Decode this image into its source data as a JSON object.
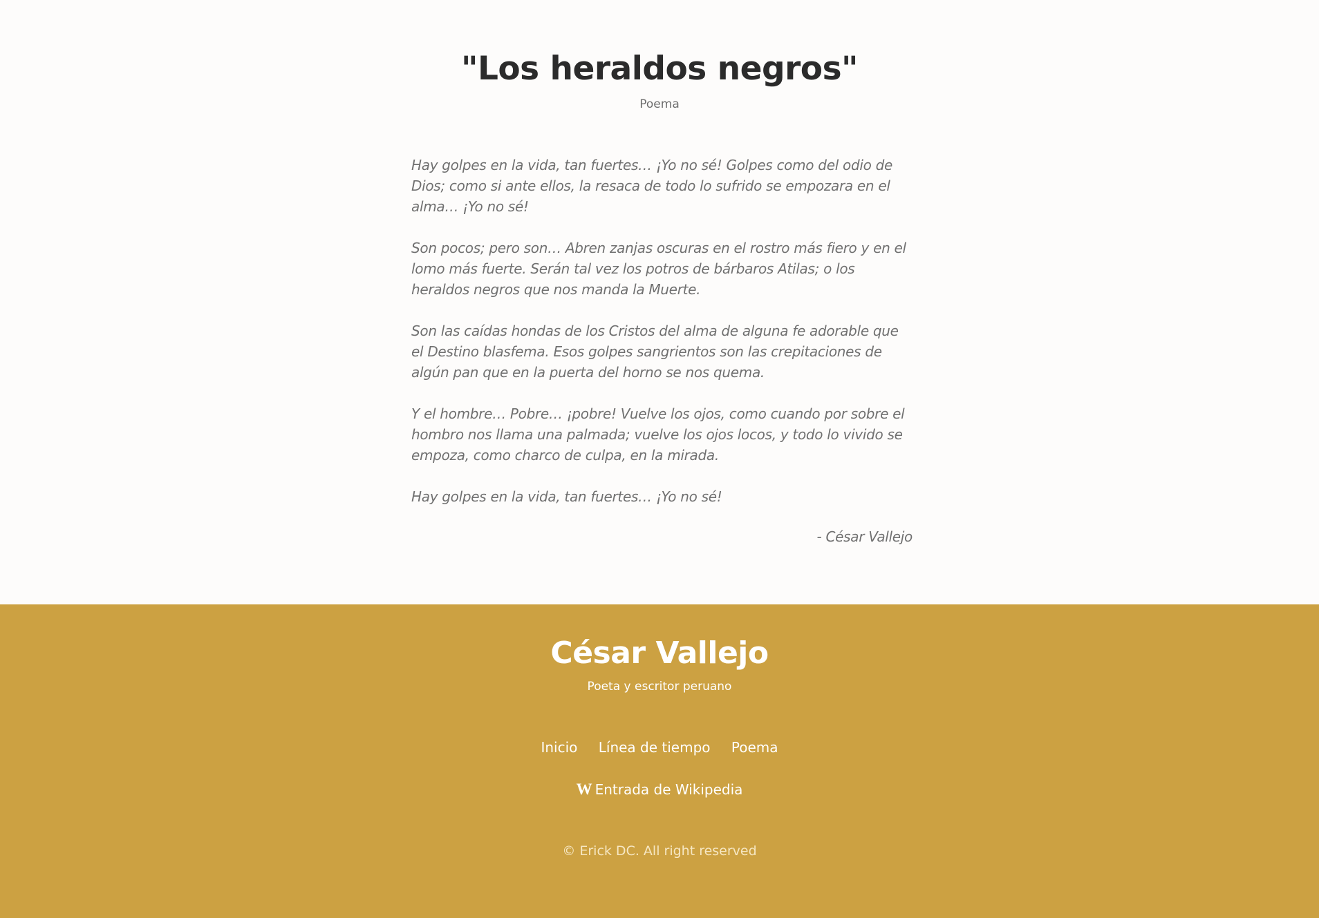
{
  "poem": {
    "title": "\"Los heraldos negros\"",
    "subtitle": "Poema",
    "stanzas": [
      "Hay golpes en la vida, tan fuertes… ¡Yo no sé! Golpes como del odio de Dios; como si ante ellos, la resaca de todo lo sufrido se empozara en el alma… ¡Yo no sé!",
      "Son pocos; pero son… Abren zanjas oscuras en el rostro más fiero y en el lomo más fuerte. Serán tal vez los potros de bárbaros Atilas; o los heraldos negros que nos manda la Muerte.",
      "Son las caídas hondas de los Cristos del alma de alguna fe adorable que el Destino blasfema. Esos golpes sangrientos son las crepitaciones de algún pan que en la puerta del horno se nos quema.",
      "Y el hombre… Pobre… ¡pobre! Vuelve los ojos, como cuando por sobre el hombro nos llama una palmada; vuelve los ojos locos, y todo lo vivido se empoza, como charco de culpa, en la mirada.",
      "Hay golpes en la vida, tan fuertes… ¡Yo no sé!"
    ],
    "author": "- César Vallejo"
  },
  "footer": {
    "name": "César Vallejo",
    "tagline": "Poeta y escritor peruano",
    "nav": [
      "Inicio",
      "Línea de tiempo",
      "Poema"
    ],
    "wiki_icon": "W",
    "wiki_label": "Entrada de Wikipedia",
    "copyright": "© Erick DC. All right reserved"
  },
  "colors": {
    "footer_bg": "#cca142",
    "page_bg": "#fdfcfb",
    "title": "#2b2b2b",
    "body_text": "#707070"
  }
}
